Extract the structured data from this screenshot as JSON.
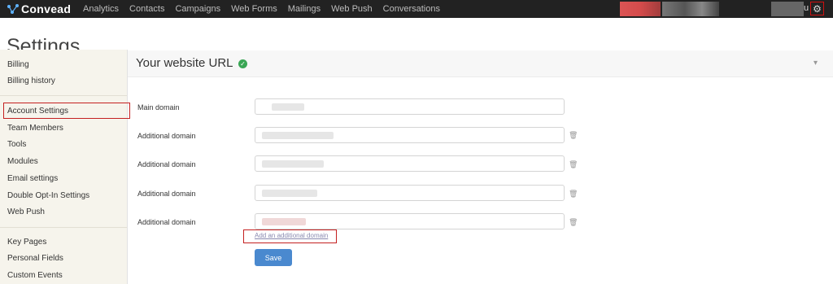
{
  "header": {
    "logo_text": "Convead",
    "nav": [
      "Analytics",
      "Contacts",
      "Campaigns",
      "Web Forms",
      "Mailings",
      "Web Push",
      "Conversations"
    ],
    "user_initial": "u",
    "settings_icon": "gear-icon"
  },
  "page": {
    "title": "Settings"
  },
  "sidebar": {
    "group1": [
      "Billing",
      "Billing history"
    ],
    "group2": [
      "Account Settings",
      "Team Members",
      "Tools",
      "Modules",
      "Email settings",
      "Double Opt-In Settings",
      "Web Push"
    ],
    "group3": [
      "Key Pages",
      "Personal Fields",
      "Custom Events"
    ],
    "active": "Account Settings"
  },
  "panel": {
    "title": "Your website URL",
    "status_icon": "check-circle-icon",
    "collapse_icon": "chevron-down-icon"
  },
  "form": {
    "main_label": "Main domain",
    "additional_label": "Additional domain",
    "additional_count": 4,
    "delete_icon": "trash-icon",
    "add_link": "Add an additional domain",
    "save_label": "Save"
  },
  "colors": {
    "topbar": "#222222",
    "sidebar_bg": "#f6f4ec",
    "accent_button": "#4a89cf",
    "highlight": "#c42020",
    "success": "#3aa655"
  }
}
